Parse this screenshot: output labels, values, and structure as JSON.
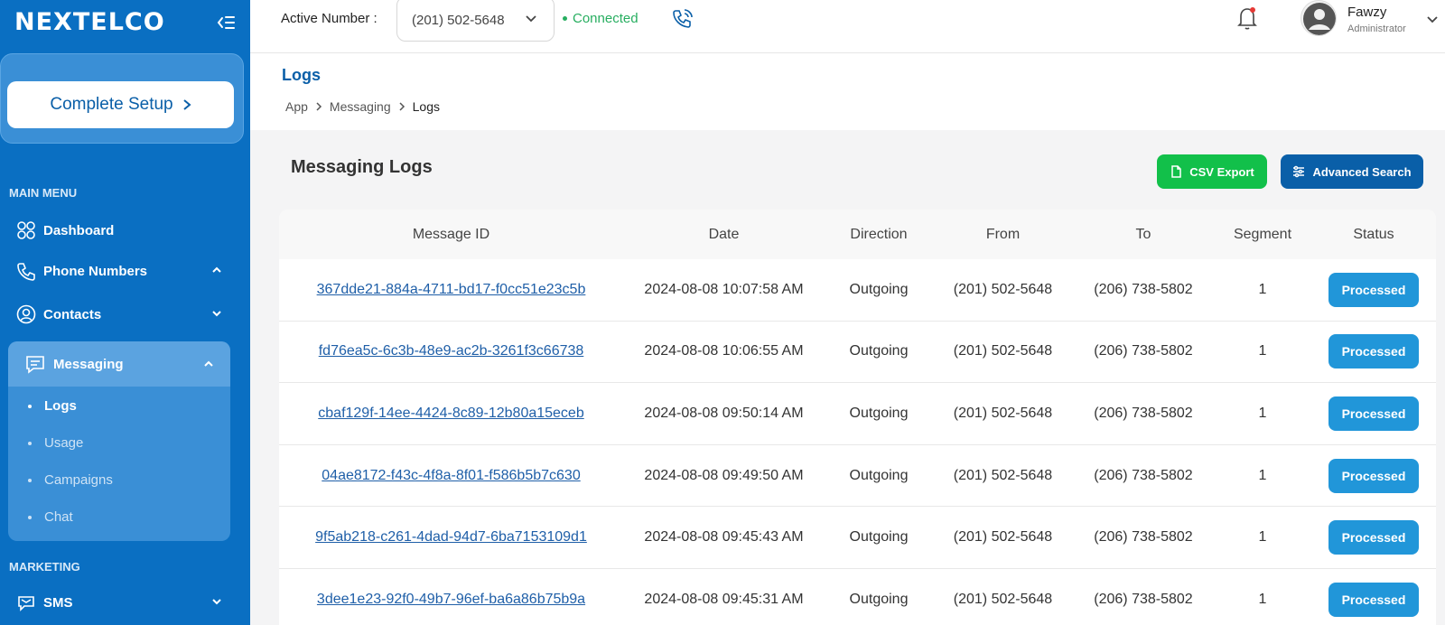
{
  "sidebar": {
    "logo": "NEXTELCO",
    "setup_button": "Complete Setup",
    "main_menu_heading": "MAIN MENU",
    "items": {
      "dashboard": "Dashboard",
      "phone_numbers": "Phone Numbers",
      "contacts": "Contacts",
      "messaging": "Messaging"
    },
    "messaging_sub": [
      "Logs",
      "Usage",
      "Campaigns",
      "Chat"
    ],
    "marketing_heading": "MARKETING",
    "sms": "SMS"
  },
  "topbar": {
    "active_label": "Active Number :",
    "active_number": "(201) 502-5648",
    "status": "Connected",
    "user_name": "Fawzy",
    "user_role": "Administrator"
  },
  "page": {
    "title": "Logs",
    "breadcrumb": [
      "App",
      "Messaging",
      "Logs"
    ],
    "section_title": "Messaging Logs",
    "csv_button": "CSV Export",
    "advanced_button": "Advanced Search"
  },
  "table": {
    "headers": [
      "Message ID",
      "Date",
      "Direction",
      "From",
      "To",
      "Segment",
      "Status"
    ],
    "rows": [
      {
        "id": "367dde21-884a-4711-bd17-f0cc51e23c5b",
        "date": "2024-08-08 10:07:58 AM",
        "direction": "Outgoing",
        "from": "(201) 502-5648",
        "to": "(206) 738-5802",
        "segment": "1",
        "status": "Processed"
      },
      {
        "id": "fd76ea5c-6c3b-48e9-ac2b-3261f3c66738",
        "date": "2024-08-08 10:06:55 AM",
        "direction": "Outgoing",
        "from": "(201) 502-5648",
        "to": "(206) 738-5802",
        "segment": "1",
        "status": "Processed"
      },
      {
        "id": "cbaf129f-14ee-4424-8c89-12b80a15eceb",
        "date": "2024-08-08 09:50:14 AM",
        "direction": "Outgoing",
        "from": "(201) 502-5648",
        "to": "(206) 738-5802",
        "segment": "1",
        "status": "Processed"
      },
      {
        "id": "04ae8172-f43c-4f8a-8f01-f586b5b7c630",
        "date": "2024-08-08 09:49:50 AM",
        "direction": "Outgoing",
        "from": "(201) 502-5648",
        "to": "(206) 738-5802",
        "segment": "1",
        "status": "Processed"
      },
      {
        "id": "9f5ab218-c261-4dad-94d7-6ba7153109d1",
        "date": "2024-08-08 09:45:43 AM",
        "direction": "Outgoing",
        "from": "(201) 502-5648",
        "to": "(206) 738-5802",
        "segment": "1",
        "status": "Processed"
      },
      {
        "id": "3dee1e23-92f0-49b7-96ef-ba6a86b75b9a",
        "date": "2024-08-08 09:45:31 AM",
        "direction": "Outgoing",
        "from": "(201) 502-5648",
        "to": "(206) 738-5802",
        "segment": "1",
        "status": "Processed"
      }
    ]
  },
  "colors": {
    "sidebar": "#0a6fc2",
    "connected": "#27ae60",
    "csv": "#12c04a",
    "advanced": "#0a5fa8",
    "badge": "#2196d9"
  }
}
